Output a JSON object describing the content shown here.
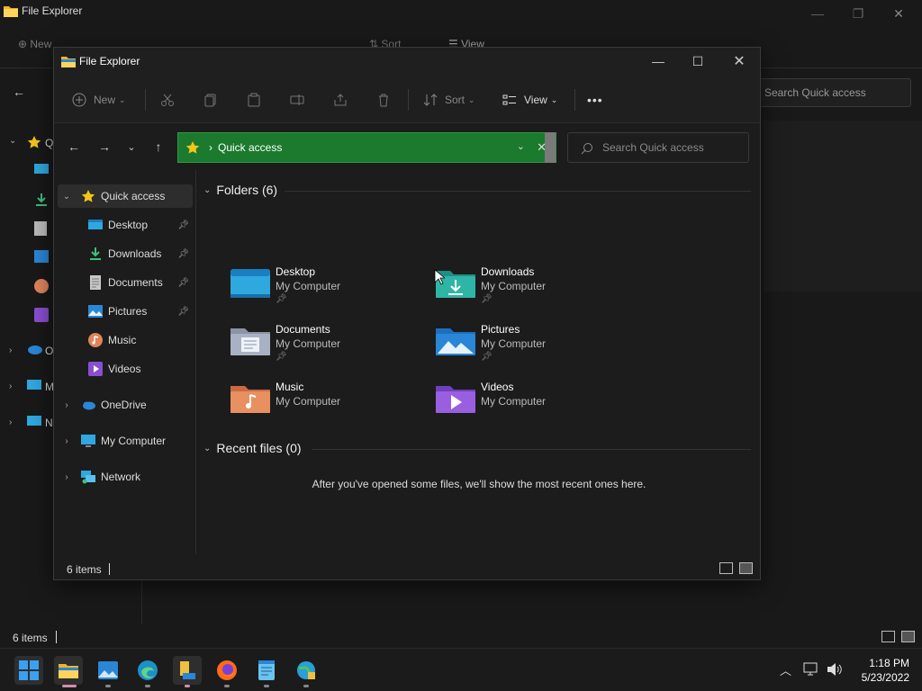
{
  "background_window": {
    "title": "File Explorer",
    "toolbar": {
      "new": "New",
      "sort": "Sort",
      "view": "View"
    },
    "search_placeholder": "Search Quick access",
    "sidebar_letters": [
      "Q",
      "O",
      "M",
      "N"
    ],
    "status": "6 items"
  },
  "window": {
    "title": "File Explorer",
    "toolbar": {
      "new_label": "New",
      "sort_label": "Sort",
      "view_label": "View",
      "more_label": "•••"
    },
    "address": {
      "location": "Quick access"
    },
    "search": {
      "placeholder": "Search Quick access"
    },
    "sidebar": {
      "items": [
        {
          "label": "Quick access",
          "icon": "star-icon"
        },
        {
          "label": "Desktop",
          "icon": "desktop-icon",
          "pinned": true
        },
        {
          "label": "Downloads",
          "icon": "download-icon",
          "pinned": true
        },
        {
          "label": "Documents",
          "icon": "document-icon",
          "pinned": true
        },
        {
          "label": "Pictures",
          "icon": "pictures-icon",
          "pinned": true
        },
        {
          "label": "Music",
          "icon": "music-icon"
        },
        {
          "label": "Videos",
          "icon": "videos-icon"
        },
        {
          "label": "OneDrive",
          "icon": "cloud-icon"
        },
        {
          "label": "My Computer",
          "icon": "computer-icon"
        },
        {
          "label": "Network",
          "icon": "network-icon"
        }
      ]
    },
    "folders_header": "Folders (6)",
    "folders": [
      {
        "name": "Desktop",
        "location": "My Computer",
        "pinned": true
      },
      {
        "name": "Downloads",
        "location": "My Computer",
        "pinned": true
      },
      {
        "name": "Documents",
        "location": "My Computer",
        "pinned": true
      },
      {
        "name": "Pictures",
        "location": "My Computer",
        "pinned": true
      },
      {
        "name": "Music",
        "location": "My Computer",
        "pinned": false
      },
      {
        "name": "Videos",
        "location": "My Computer",
        "pinned": false
      }
    ],
    "recent_header": "Recent files (0)",
    "recent_empty": "After you've opened some files, we'll show the most recent ones here.",
    "status": "6 items"
  },
  "taskbar": {
    "apps": [
      "start-icon",
      "file-explorer-icon",
      "photos-icon",
      "edge-icon",
      "file-explorer-pinned-icon",
      "firefox-icon",
      "notepad-icon",
      "network-globe-icon"
    ],
    "time": "1:18 PM",
    "date": "5/23/2022"
  },
  "colors": {
    "address_bg": "#1b7a2e",
    "accent_star": "#f5c518"
  }
}
